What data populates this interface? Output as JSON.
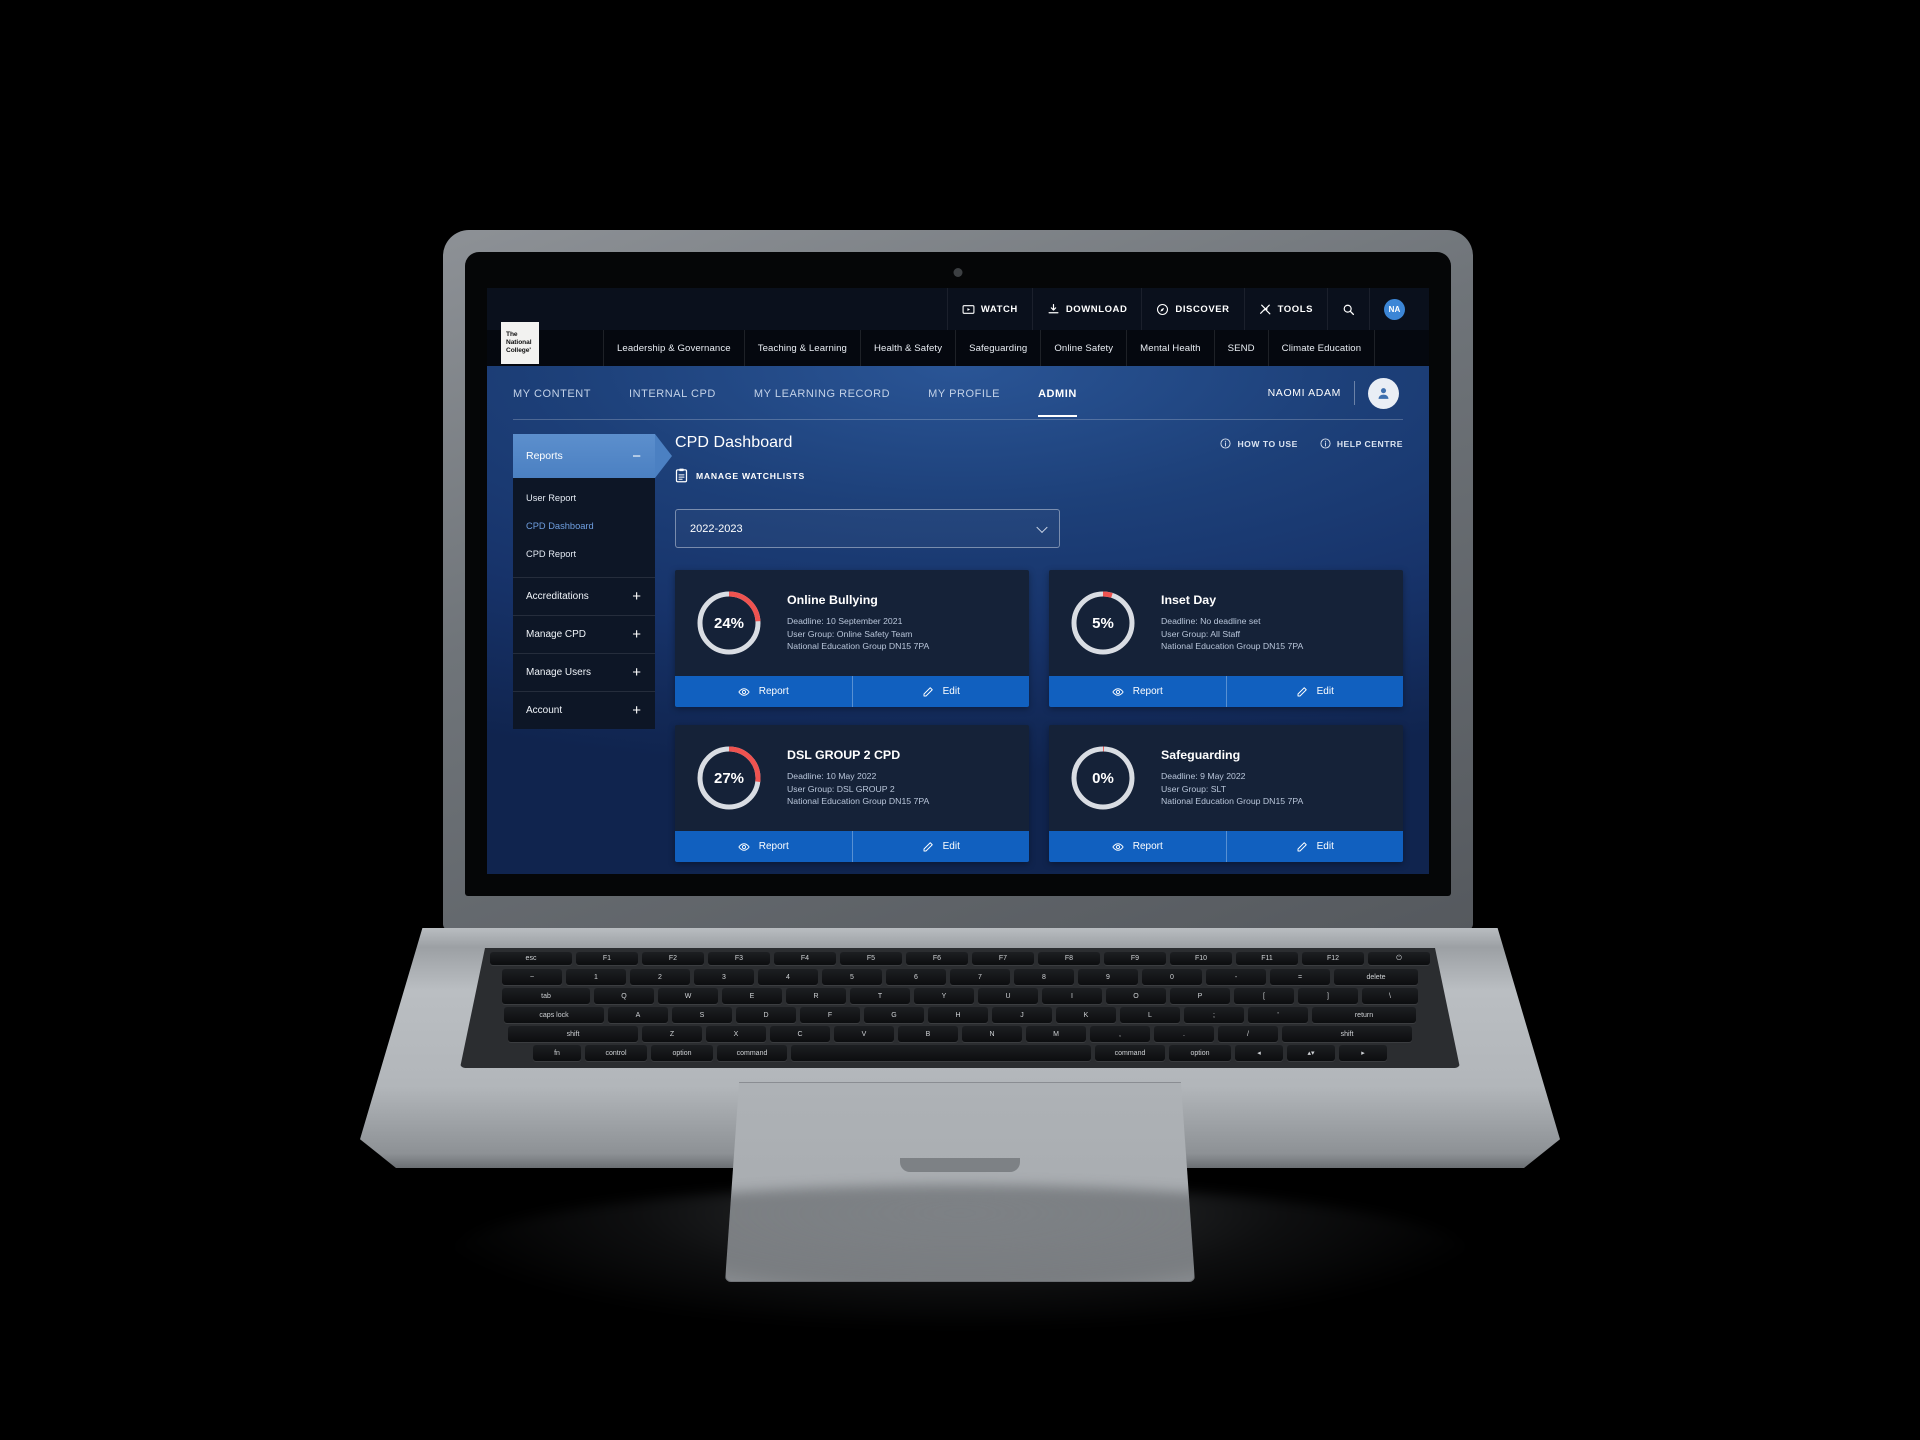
{
  "utility_bar": {
    "items": [
      {
        "label": "WATCH",
        "icon": "video-icon"
      },
      {
        "label": "DOWNLOAD",
        "icon": "download-icon"
      },
      {
        "label": "DISCOVER",
        "icon": "compass-icon"
      },
      {
        "label": "TOOLS",
        "icon": "tools-icon"
      }
    ],
    "search_icon": "search-icon",
    "avatar_initials": "NA"
  },
  "brand": {
    "logo_line1": "The",
    "logo_line2": "National",
    "logo_line3": "College'"
  },
  "category_nav": [
    "Leadership & Governance",
    "Teaching & Learning",
    "Health & Safety",
    "Safeguarding",
    "Online Safety",
    "Mental Health",
    "SEND",
    "Climate Education"
  ],
  "tabs": [
    {
      "label": "MY CONTENT",
      "active": false
    },
    {
      "label": "INTERNAL CPD",
      "active": false
    },
    {
      "label": "MY LEARNING RECORD",
      "active": false
    },
    {
      "label": "MY PROFILE",
      "active": false
    },
    {
      "label": "ADMIN",
      "active": true
    }
  ],
  "user": {
    "name": "NAOMI ADAM",
    "avatar_icon": "person-icon"
  },
  "sidebar": {
    "active_group": {
      "label": "Reports",
      "toggle": "−"
    },
    "sub_items": [
      {
        "label": "User Report",
        "active": false
      },
      {
        "label": "CPD Dashboard",
        "active": true
      },
      {
        "label": "CPD Report",
        "active": false
      }
    ],
    "groups": [
      {
        "label": "Accreditations",
        "toggle": "+"
      },
      {
        "label": "Manage CPD",
        "toggle": "+"
      },
      {
        "label": "Manage Users",
        "toggle": "+"
      },
      {
        "label": "Account",
        "toggle": "+"
      }
    ]
  },
  "main": {
    "page_title": "CPD Dashboard",
    "manage_watchlists": "MANAGE WATCHLISTS",
    "head_links": [
      {
        "label": "HOW TO USE",
        "icon": "info-icon"
      },
      {
        "label": "HELP CENTRE",
        "icon": "info-icon"
      }
    ],
    "year_select": {
      "value": "2022-2023",
      "chevron": "chevron-down-icon"
    },
    "buttons": {
      "report": "Report",
      "edit": "Edit"
    }
  },
  "chart_data": {
    "type": "pie",
    "title": "CPD completion by course",
    "legend_position": "none",
    "accent_complete": "#d9dde3",
    "accent_remaining": "#ef5350",
    "cards": [
      {
        "title": "Online Bullying",
        "percent": 24,
        "percent_label": "24%",
        "deadline": "Deadline: 10 September 2021",
        "user_group": "User Group: Online Safety Team",
        "organisation": "National Education Group DN15 7PA"
      },
      {
        "title": "Inset Day",
        "percent": 5,
        "percent_label": "5%",
        "deadline": "Deadline: No deadline set",
        "user_group": "User Group: All Staff",
        "organisation": "National Education Group DN15 7PA"
      },
      {
        "title": "DSL GROUP 2 CPD",
        "percent": 27,
        "percent_label": "27%",
        "deadline": "Deadline: 10 May 2022",
        "user_group": "User Group: DSL GROUP 2",
        "organisation": "National Education Group DN15 7PA"
      },
      {
        "title": "Safeguarding",
        "percent": 0,
        "percent_label": "0%",
        "deadline": "Deadline: 9 May 2022",
        "user_group": "User Group: SLT",
        "organisation": "National Education Group DN15 7PA"
      }
    ]
  },
  "keyboard": {
    "row_fn": [
      "esc",
      "F1",
      "F2",
      "F3",
      "F4",
      "F5",
      "F6",
      "F7",
      "F8",
      "F9",
      "F10",
      "F11",
      "F12",
      "⏻"
    ],
    "row_num": [
      "~",
      "1",
      "2",
      "3",
      "4",
      "5",
      "6",
      "7",
      "8",
      "9",
      "0",
      "-",
      "=",
      "delete"
    ],
    "row_q": [
      "tab",
      "Q",
      "W",
      "E",
      "R",
      "T",
      "Y",
      "U",
      "I",
      "O",
      "P",
      "[",
      "]",
      "\\"
    ],
    "row_a": [
      "caps lock",
      "A",
      "S",
      "D",
      "F",
      "G",
      "H",
      "J",
      "K",
      "L",
      ";",
      "'",
      "return"
    ],
    "row_z": [
      "shift",
      "Z",
      "X",
      "C",
      "V",
      "B",
      "N",
      "M",
      ",",
      ".",
      "/",
      "shift"
    ],
    "row_sp": [
      "fn",
      "control",
      "option",
      "command",
      "",
      "command",
      "option",
      "◂",
      "▴▾",
      "▸"
    ]
  }
}
